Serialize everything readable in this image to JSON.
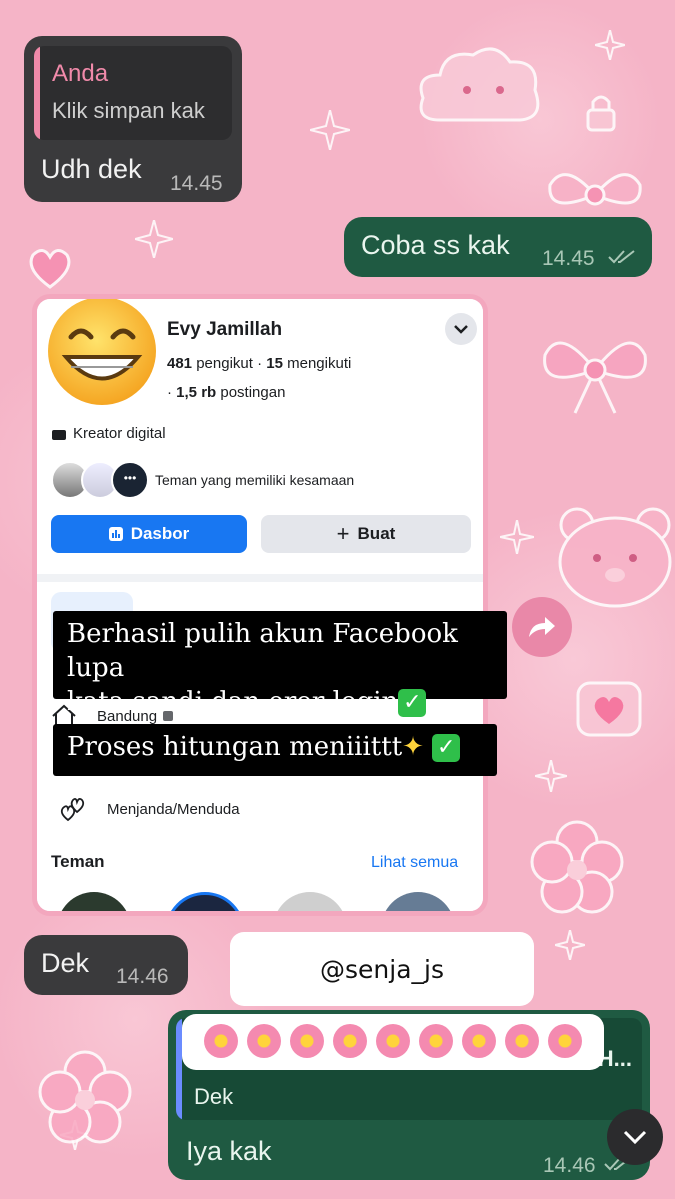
{
  "chat": {
    "reply_author": "Anda",
    "reply_text": "Klik simpan kak",
    "msg1": {
      "text": "Udh dek",
      "time": "14.45"
    },
    "msg2": {
      "text": "Coba ss kak",
      "time": "14.45"
    },
    "screenshot_time": "14.45",
    "msg3": {
      "text": "Dek",
      "time": "14.46"
    },
    "watermark": "@senja_js",
    "quoted_truncated": "H...",
    "quoted_text": "Dek",
    "msg4": {
      "text": "Iya kak",
      "time": "14.46"
    }
  },
  "profile": {
    "name": "Evy Jamillah",
    "followers_count": "481",
    "followers_label": "pengikut",
    "following_count": "15",
    "following_label": "mengikuti",
    "posts_count": "1,5 rb",
    "posts_label": "postingan",
    "category": "Kreator digital",
    "mutual_text": "Teman yang memiliki kesamaan",
    "dashboard_button": "Dasbor",
    "create_button": "Buat",
    "city": "Bandung",
    "relationship": "Menjanda/Menduda",
    "friends_heading": "Teman",
    "see_all": "Lihat semua"
  },
  "overlay": {
    "line1": "Berhasil pulih akun Facebook lupa",
    "line2": "kata sandi dan eror login",
    "line3": "Proses hitungan meniiittt"
  },
  "colors": {
    "background": "#f5b4c7",
    "incoming_bubble": "#3a3a3c",
    "outgoing_bubble": "#1f5a42",
    "facebook_blue": "#1877f2",
    "accent_pink": "#e77fa0"
  }
}
